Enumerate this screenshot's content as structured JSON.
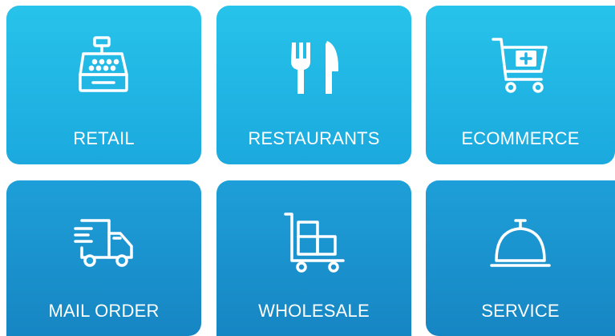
{
  "tiles": [
    {
      "label": "RETAIL",
      "icon": "cash-register-icon"
    },
    {
      "label": "RESTAURANTS",
      "icon": "fork-knife-icon"
    },
    {
      "label": "ECOMMERCE",
      "icon": "shopping-cart-icon"
    },
    {
      "label": "MAIL ORDER",
      "icon": "delivery-truck-icon"
    },
    {
      "label": "WHOLESALE",
      "icon": "hand-truck-boxes-icon"
    },
    {
      "label": "SERVICE",
      "icon": "service-bell-icon"
    }
  ],
  "colors": {
    "top_gradient_start": "#27c3ea",
    "top_gradient_end": "#1ba9de",
    "bottom_gradient_start": "#1e9fd8",
    "bottom_gradient_end": "#1686c3",
    "text": "#ffffff"
  }
}
